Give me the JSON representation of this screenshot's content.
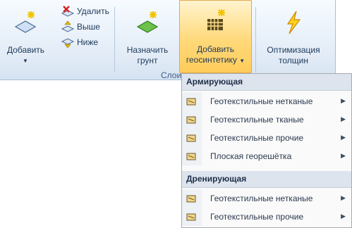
{
  "ribbon": {
    "add_button": "Добавить",
    "delete_button": "Удалить",
    "up_button": "Выше",
    "down_button": "Ниже",
    "assign_soil_line1": "Назначить",
    "assign_soil_line2": "грунт",
    "add_geo_line1": "Добавить",
    "add_geo_line2": "геосинтетику",
    "optimize_line1": "Оптимизация",
    "optimize_line2": "толщин",
    "group_label": "Слои"
  },
  "menu": {
    "section1": "Армирующая",
    "section1_items": [
      "Геотекстильные нетканые",
      "Геотекстильные тканые",
      "Геотекстильные прочие",
      "Плоская георешётка"
    ],
    "section2": "Дренирующая",
    "section2_items": [
      "Геотекстильные нетканые",
      "Геотекстильные прочие"
    ]
  },
  "colors": {
    "active_button": "#ffd97a",
    "menu_header": "#dde4ee"
  }
}
